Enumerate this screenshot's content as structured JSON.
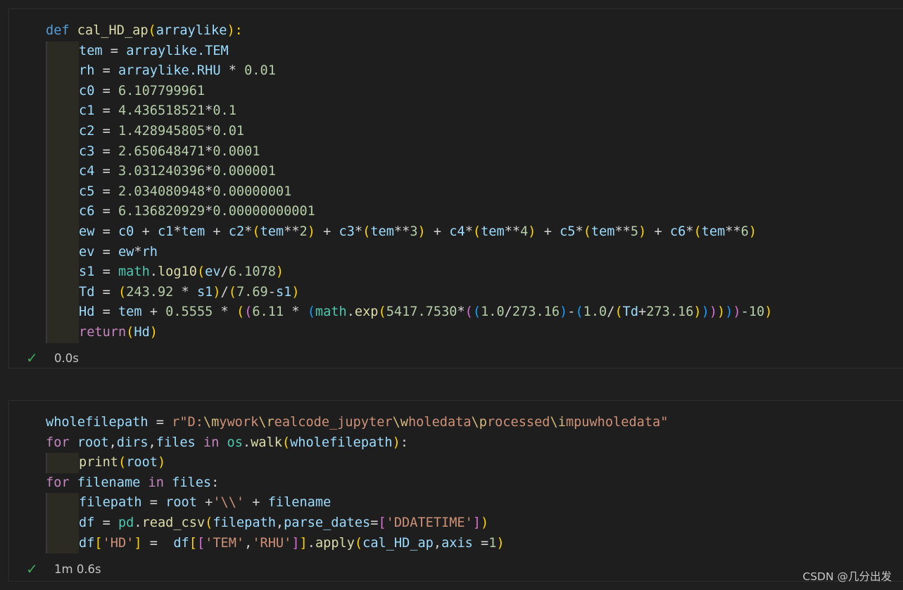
{
  "cells": [
    {
      "status_time": "0.0s",
      "lines": [
        [
          [
            "def ",
            "kw"
          ],
          [
            "cal_HD_ap",
            "fn"
          ],
          [
            "(",
            "b1"
          ],
          [
            "arraylike",
            "var"
          ],
          [
            "):",
            "b1"
          ]
        ],
        [
          [
            "I",
            ""
          ],
          [
            "tem",
            "var"
          ],
          [
            " = ",
            "op"
          ],
          [
            "arraylike",
            "var"
          ],
          [
            ".TEM",
            "var"
          ]
        ],
        [
          [
            "I",
            ""
          ],
          [
            "rh",
            "var"
          ],
          [
            " = ",
            "op"
          ],
          [
            "arraylike",
            "var"
          ],
          [
            ".RHU",
            "var"
          ],
          [
            " * ",
            "op"
          ],
          [
            "0.01",
            "num"
          ]
        ],
        [
          [
            "I",
            ""
          ],
          [
            "c0",
            "var"
          ],
          [
            " = ",
            "op"
          ],
          [
            "6.107799961",
            "num"
          ]
        ],
        [
          [
            "I",
            ""
          ],
          [
            "c1",
            "var"
          ],
          [
            " = ",
            "op"
          ],
          [
            "4.436518521",
            "num"
          ],
          [
            "*",
            "op"
          ],
          [
            "0.1",
            "num"
          ]
        ],
        [
          [
            "I",
            ""
          ],
          [
            "c2",
            "var"
          ],
          [
            " = ",
            "op"
          ],
          [
            "1.428945805",
            "num"
          ],
          [
            "*",
            "op"
          ],
          [
            "0.01",
            "num"
          ]
        ],
        [
          [
            "I",
            ""
          ],
          [
            "c3",
            "var"
          ],
          [
            " = ",
            "op"
          ],
          [
            "2.650648471",
            "num"
          ],
          [
            "*",
            "op"
          ],
          [
            "0.0001",
            "num"
          ]
        ],
        [
          [
            "I",
            ""
          ],
          [
            "c4",
            "var"
          ],
          [
            " = ",
            "op"
          ],
          [
            "3.031240396",
            "num"
          ],
          [
            "*",
            "op"
          ],
          [
            "0.000001",
            "num"
          ]
        ],
        [
          [
            "I",
            ""
          ],
          [
            "c5",
            "var"
          ],
          [
            " = ",
            "op"
          ],
          [
            "2.034080948",
            "num"
          ],
          [
            "*",
            "op"
          ],
          [
            "0.00000001",
            "num"
          ]
        ],
        [
          [
            "I",
            ""
          ],
          [
            "c6",
            "var"
          ],
          [
            " = ",
            "op"
          ],
          [
            "6.136820929",
            "num"
          ],
          [
            "*",
            "op"
          ],
          [
            "0.00000000001",
            "num"
          ]
        ],
        [
          [
            "I",
            ""
          ],
          [
            "ew",
            "var"
          ],
          [
            " = ",
            "op"
          ],
          [
            "c0",
            "var"
          ],
          [
            " + ",
            "op"
          ],
          [
            "c1",
            "var"
          ],
          [
            "*",
            "op"
          ],
          [
            "tem",
            "var"
          ],
          [
            " + ",
            "op"
          ],
          [
            "c2",
            "var"
          ],
          [
            "*",
            "op"
          ],
          [
            "(",
            "b1"
          ],
          [
            "tem",
            "var"
          ],
          [
            "**",
            "op"
          ],
          [
            "2",
            "num"
          ],
          [
            ")",
            "b1"
          ],
          [
            " + ",
            "op"
          ],
          [
            "c3",
            "var"
          ],
          [
            "*",
            "op"
          ],
          [
            "(",
            "b1"
          ],
          [
            "tem",
            "var"
          ],
          [
            "**",
            "op"
          ],
          [
            "3",
            "num"
          ],
          [
            ")",
            "b1"
          ],
          [
            " + ",
            "op"
          ],
          [
            "c4",
            "var"
          ],
          [
            "*",
            "op"
          ],
          [
            "(",
            "b1"
          ],
          [
            "tem",
            "var"
          ],
          [
            "**",
            "op"
          ],
          [
            "4",
            "num"
          ],
          [
            ")",
            "b1"
          ],
          [
            " + ",
            "op"
          ],
          [
            "c5",
            "var"
          ],
          [
            "*",
            "op"
          ],
          [
            "(",
            "b1"
          ],
          [
            "tem",
            "var"
          ],
          [
            "**",
            "op"
          ],
          [
            "5",
            "num"
          ],
          [
            ")",
            "b1"
          ],
          [
            " + ",
            "op"
          ],
          [
            "c6",
            "var"
          ],
          [
            "*",
            "op"
          ],
          [
            "(",
            "b1"
          ],
          [
            "tem",
            "var"
          ],
          [
            "**",
            "op"
          ],
          [
            "6",
            "num"
          ],
          [
            ")",
            "b1"
          ]
        ],
        [
          [
            "I",
            ""
          ],
          [
            "ev",
            "var"
          ],
          [
            " = ",
            "op"
          ],
          [
            "ew",
            "var"
          ],
          [
            "*",
            "op"
          ],
          [
            "rh",
            "var"
          ]
        ],
        [
          [
            "I",
            ""
          ],
          [
            "s1",
            "var"
          ],
          [
            " = ",
            "op"
          ],
          [
            "math",
            "mod"
          ],
          [
            ".",
            "op"
          ],
          [
            "log10",
            "fn"
          ],
          [
            "(",
            "b1"
          ],
          [
            "ev",
            "var"
          ],
          [
            "/",
            "op"
          ],
          [
            "6.1078",
            "num"
          ],
          [
            ")",
            "b1"
          ]
        ],
        [
          [
            "I",
            ""
          ],
          [
            "Td",
            "var"
          ],
          [
            " = ",
            "op"
          ],
          [
            "(",
            "b1"
          ],
          [
            "243.92",
            "num"
          ],
          [
            " * ",
            "op"
          ],
          [
            "s1",
            "var"
          ],
          [
            ")",
            "b1"
          ],
          [
            "/",
            "op"
          ],
          [
            "(",
            "b1"
          ],
          [
            "7.69",
            "num"
          ],
          [
            "-",
            "op"
          ],
          [
            "s1",
            "var"
          ],
          [
            ")",
            "b1"
          ]
        ],
        [
          [
            "I",
            ""
          ],
          [
            "Hd",
            "var"
          ],
          [
            " = ",
            "op"
          ],
          [
            "tem",
            "var"
          ],
          [
            " + ",
            "op"
          ],
          [
            "0.5555",
            "num"
          ],
          [
            " * ",
            "op"
          ],
          [
            "(",
            "b1"
          ],
          [
            "(",
            "b2"
          ],
          [
            "6.11",
            "num"
          ],
          [
            " * ",
            "op"
          ],
          [
            "(",
            "b3"
          ],
          [
            "math",
            "mod"
          ],
          [
            ".",
            "op"
          ],
          [
            "exp",
            "fn"
          ],
          [
            "(",
            "b1"
          ],
          [
            "5417.7530",
            "num"
          ],
          [
            "*",
            "op"
          ],
          [
            "(",
            "b2"
          ],
          [
            "(",
            "b3"
          ],
          [
            "1.0",
            "num"
          ],
          [
            "/",
            "op"
          ],
          [
            "273.16",
            "num"
          ],
          [
            ")",
            "b3"
          ],
          [
            "-",
            "op"
          ],
          [
            "(",
            "b3"
          ],
          [
            "1.0",
            "num"
          ],
          [
            "/",
            "op"
          ],
          [
            "(",
            "b1"
          ],
          [
            "Td",
            "var"
          ],
          [
            "+",
            "op"
          ],
          [
            "273.16",
            "num"
          ],
          [
            ")",
            "b1"
          ],
          [
            ")",
            "b3"
          ],
          [
            ")",
            "b2"
          ],
          [
            ")",
            "b1"
          ],
          [
            ")",
            "b3"
          ],
          [
            ")",
            "b2"
          ],
          [
            "-",
            "op"
          ],
          [
            "10",
            "num"
          ],
          [
            ")",
            "b1"
          ]
        ],
        [
          [
            "I",
            ""
          ],
          [
            "return",
            "ctl"
          ],
          [
            "(",
            "b1"
          ],
          [
            "Hd",
            "var"
          ],
          [
            ")",
            "b1"
          ]
        ]
      ]
    },
    {
      "status_time": "1m 0.6s",
      "lines": [
        [
          [
            "wholefilepath",
            "var"
          ],
          [
            " = ",
            "op"
          ],
          [
            "r\"D:",
            "str"
          ],
          [
            "\\m",
            "esc"
          ],
          [
            "ywork",
            "str"
          ],
          [
            "\\r",
            "esc"
          ],
          [
            "ealcode_jupyter",
            "str"
          ],
          [
            "\\w",
            "esc"
          ],
          [
            "holedata",
            "str"
          ],
          [
            "\\p",
            "esc"
          ],
          [
            "rocessed",
            "str"
          ],
          [
            "\\i",
            "esc"
          ],
          [
            "mpuwholedata\"",
            "str"
          ]
        ],
        [
          [
            "for ",
            "ctl"
          ],
          [
            "root",
            "var"
          ],
          [
            ",",
            "op"
          ],
          [
            "dirs",
            "var"
          ],
          [
            ",",
            "op"
          ],
          [
            "files",
            "var"
          ],
          [
            " in ",
            "ctl"
          ],
          [
            "os",
            "mod"
          ],
          [
            ".",
            "op"
          ],
          [
            "walk",
            "fn"
          ],
          [
            "(",
            "b1"
          ],
          [
            "wholefilepath",
            "var"
          ],
          [
            ")",
            "b1"
          ],
          [
            ":",
            "op"
          ]
        ],
        [
          [
            "I",
            ""
          ],
          [
            "print",
            "fn"
          ],
          [
            "(",
            "b1"
          ],
          [
            "root",
            "var"
          ],
          [
            ")",
            "b1"
          ]
        ],
        [
          [
            "for ",
            "ctl"
          ],
          [
            "filename",
            "var"
          ],
          [
            " in ",
            "ctl"
          ],
          [
            "files",
            "var"
          ],
          [
            ":",
            "op"
          ]
        ],
        [
          [
            "I",
            ""
          ],
          [
            "filepath",
            "var"
          ],
          [
            " = ",
            "op"
          ],
          [
            "root",
            "var"
          ],
          [
            " +",
            "op"
          ],
          [
            "'\\\\'",
            "str"
          ],
          [
            " + ",
            "op"
          ],
          [
            "filename",
            "var"
          ]
        ],
        [
          [
            "I",
            ""
          ],
          [
            "df",
            "var"
          ],
          [
            " = ",
            "op"
          ],
          [
            "pd",
            "mod"
          ],
          [
            ".",
            "op"
          ],
          [
            "read_csv",
            "fn"
          ],
          [
            "(",
            "b1"
          ],
          [
            "filepath",
            "var"
          ],
          [
            ",",
            "op"
          ],
          [
            "parse_dates",
            "var"
          ],
          [
            "=",
            "op"
          ],
          [
            "[",
            "b2"
          ],
          [
            "'DDATETIME'",
            "str"
          ],
          [
            "]",
            "b2"
          ],
          [
            ")",
            "b1"
          ]
        ],
        [
          [
            "I",
            ""
          ],
          [
            "df",
            "var"
          ],
          [
            "[",
            "b1"
          ],
          [
            "'HD'",
            "str"
          ],
          [
            "]",
            "b1"
          ],
          [
            " =  ",
            "op"
          ],
          [
            "df",
            "var"
          ],
          [
            "[",
            "b1"
          ],
          [
            "[",
            "b2"
          ],
          [
            "'TEM'",
            "str"
          ],
          [
            ",",
            "op"
          ],
          [
            "'RHU'",
            "str"
          ],
          [
            "]",
            "b2"
          ],
          [
            "]",
            "b1"
          ],
          [
            ".",
            "op"
          ],
          [
            "apply",
            "fn"
          ],
          [
            "(",
            "b1"
          ],
          [
            "cal_HD_ap",
            "var"
          ],
          [
            ",",
            "op"
          ],
          [
            "axis",
            "var"
          ],
          [
            " =",
            "op"
          ],
          [
            "1",
            "num"
          ],
          [
            ")",
            "b1"
          ]
        ]
      ]
    }
  ],
  "watermark": "CSDN @几分出发",
  "icons": {
    "status": "check-icon"
  }
}
